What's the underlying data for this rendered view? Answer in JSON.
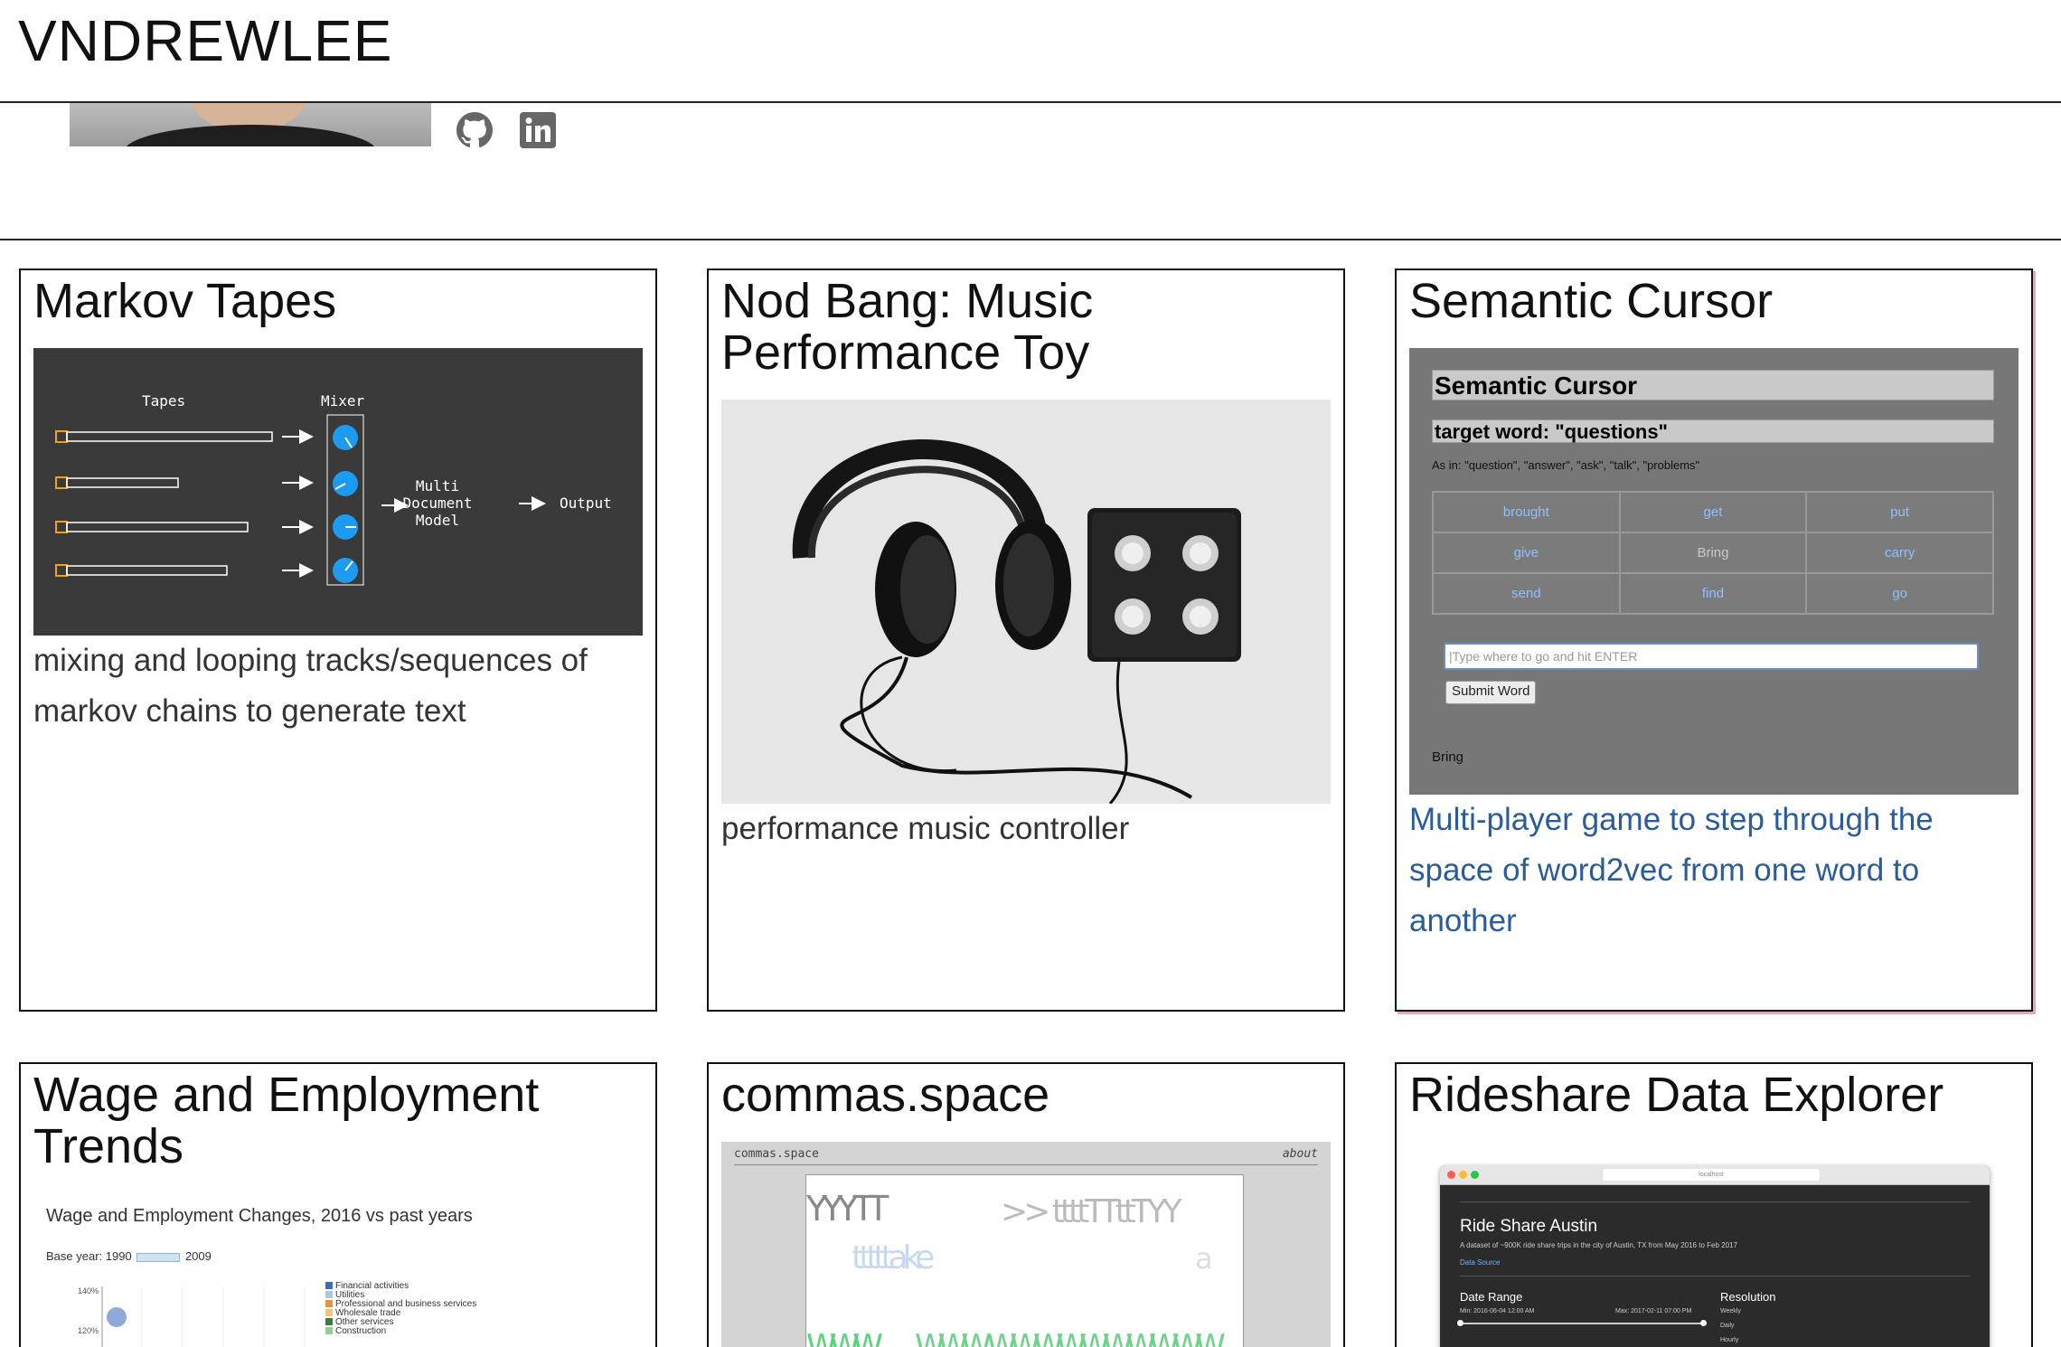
{
  "site": {
    "title": "VNDREWLEE"
  },
  "social": {
    "github_icon": "github-icon",
    "linkedin_icon": "linkedin-icon"
  },
  "projects": [
    {
      "title": "Markov Tapes",
      "description": "mixing and looping tracks/sequences of markov chains to generate text",
      "diagram": {
        "tapes": "Tapes",
        "mixer": "Mixer",
        "model_line1": "Multi",
        "model_line2": "Document",
        "model_line3": "Model",
        "output": "Output"
      }
    },
    {
      "title": "Nod Bang: Music Performance Toy",
      "description": "performance music controller"
    },
    {
      "title": "Semantic Cursor",
      "description": "Multi-player game to step through the space of word2vec from one word to another",
      "screen": {
        "heading": "Semantic Cursor",
        "target": "target word: \"questions\"",
        "as_in": "As in: \"question\", \"answer\", \"ask\", \"talk\", \"problems\"",
        "words": [
          [
            "brought",
            "get",
            "put"
          ],
          [
            "give",
            "Bring",
            "carry"
          ],
          [
            "send",
            "find",
            "go"
          ]
        ],
        "input_placeholder": "Type where to go and hit ENTER",
        "submit": "Submit Word",
        "result": "Bring"
      }
    },
    {
      "title": "Wage and Employment Trends",
      "chart": {
        "title": "Wage and Employment Changes, 2016 vs past years",
        "base_label": "Base year: 1990",
        "base_end": "2009",
        "y_ticks": [
          "140%",
          "120%"
        ],
        "legend": [
          "Financial activities",
          "Utilities",
          "Professional and business services",
          "Wholesale trade",
          "Other services",
          "Construction"
        ],
        "legend_colors": [
          "#3b6fb6",
          "#a6c7e6",
          "#e8923a",
          "#f2c27b",
          "#3f7a3f",
          "#8fd08f"
        ]
      }
    },
    {
      "title": "commas.space",
      "screen": {
        "brand": "commas.space",
        "about": "about"
      }
    },
    {
      "title": "Rideshare Data Explorer",
      "screen": {
        "address": "localhost",
        "heading": "Ride Share Austin",
        "subtitle": "A dataset of ~900K ride share trips in the city of Austin, TX from May 2016 to Feb 2017",
        "source": "Data Source",
        "date_range": "Date Range",
        "min": "Min: 2016-06-04 12:00 AM",
        "max": "Max: 2017-02-11 07:00 PM",
        "resolution": "Resolution",
        "options": [
          "Weekly",
          "Daily",
          "Hourly"
        ]
      }
    }
  ]
}
